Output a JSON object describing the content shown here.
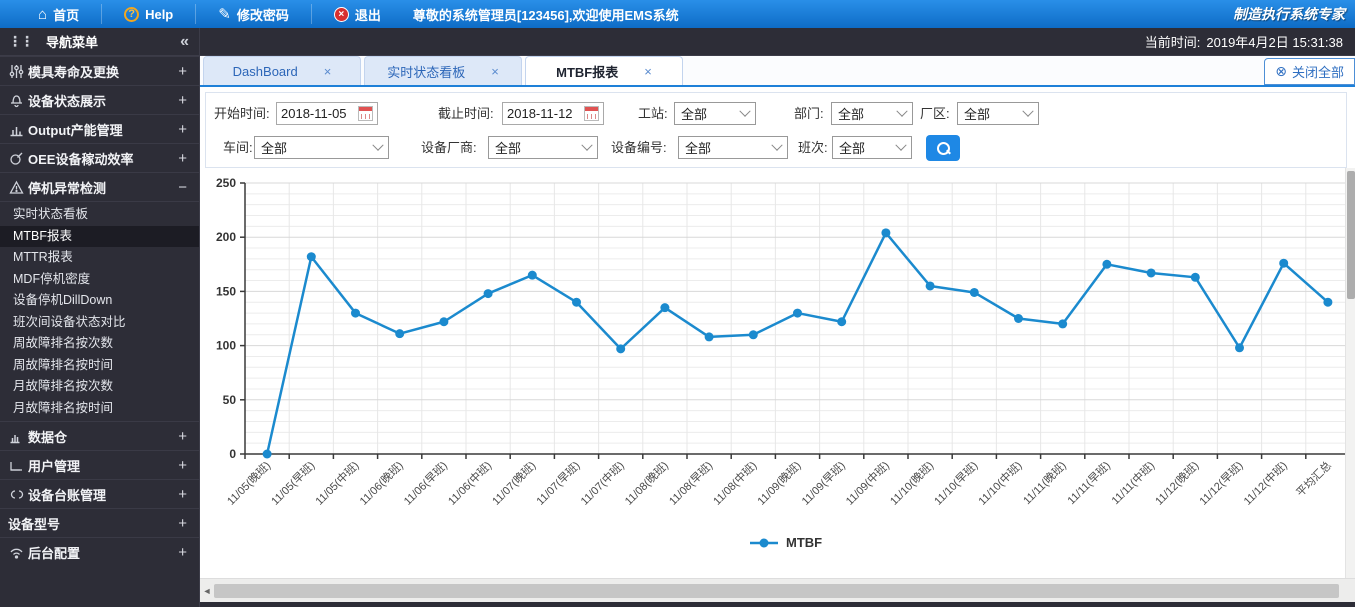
{
  "topbar": {
    "home": "首页",
    "help": "Help",
    "change_password": "修改密码",
    "logout": "退出",
    "welcome": "尊敬的系统管理员[123456],欢迎使用EMS系统",
    "brand": "制造执行系统专家"
  },
  "icons": {
    "home": "⌂",
    "help": "?",
    "edit": "✎",
    "logout": "×",
    "grip": "⋮⋮",
    "collapse": "«",
    "tab_close": "×",
    "close_all": "⊗",
    "hscroll_arrow": "◄"
  },
  "timebar": {
    "label": "当前时间:",
    "value": "2019年4月2日 15:31:38"
  },
  "sidebar": {
    "title": "导航菜单",
    "groups": [
      {
        "label": "模具寿命及更换",
        "expand": "+"
      },
      {
        "label": "设备状态展示",
        "expand": "+"
      },
      {
        "label": "Output产能管理",
        "expand": "+"
      },
      {
        "label": "OEE设备稼动效率",
        "expand": "+"
      },
      {
        "label": "停机异常检测",
        "expand": "−",
        "items": [
          "实时状态看板",
          "MTBF报表",
          "MTTR报表",
          "MDF停机密度",
          "设备停机DillDown",
          "班次间设备状态对比",
          "周故障排名按次数",
          "周故障排名按时间",
          "月故障排名按次数",
          "月故障排名按时间"
        ],
        "selected": "MTBF报表"
      },
      {
        "label": "数据仓",
        "expand": "+"
      },
      {
        "label": "用户管理",
        "expand": "+"
      },
      {
        "label": "设备台账管理",
        "expand": "+"
      },
      {
        "label": "设备型号",
        "expand": "+"
      },
      {
        "label": "后台配置",
        "expand": "+"
      }
    ]
  },
  "tabs": [
    {
      "label": "DashBoard",
      "active": false
    },
    {
      "label": "实时状态看板",
      "active": false
    },
    {
      "label": "MTBF报表",
      "active": true
    }
  ],
  "close_all_label": "关闭全部",
  "filters": {
    "row1": [
      {
        "label": "开始时间:",
        "value": "2018-11-05",
        "type": "date"
      },
      {
        "label": "截止时间:",
        "value": "2018-11-12",
        "type": "date"
      },
      {
        "label": "工站:",
        "value": "全部",
        "type": "select"
      },
      {
        "label": "部门:",
        "value": "全部",
        "type": "select"
      },
      {
        "label": "厂区:",
        "value": "全部",
        "type": "select"
      }
    ],
    "row2": [
      {
        "label": "车间:",
        "value": "全部",
        "type": "select"
      },
      {
        "label": "设备厂商:",
        "value": "全部",
        "type": "select"
      },
      {
        "label": "设备编号:",
        "value": "全部",
        "type": "select"
      },
      {
        "label": "班次:",
        "value": "全部",
        "type": "select"
      }
    ]
  },
  "chart_data": {
    "type": "line",
    "categories": [
      "11/05(晚班)",
      "11/05(早班)",
      "11/05(中班)",
      "11/06(晚班)",
      "11/06(早班)",
      "11/06(中班)",
      "11/07(晚班)",
      "11/07(早班)",
      "11/07(中班)",
      "11/08(晚班)",
      "11/08(早班)",
      "11/08(中班)",
      "11/09(晚班)",
      "11/09(早班)",
      "11/09(中班)",
      "11/10(晚班)",
      "11/10(早班)",
      "11/10(中班)",
      "11/11(晚班)",
      "11/11(早班)",
      "11/11(中班)",
      "11/12(晚班)",
      "11/12(早班)",
      "11/12(中班)",
      "平均汇总"
    ],
    "series": [
      {
        "name": "MTBF",
        "values": [
          0,
          182,
          130,
          111,
          122,
          148,
          165,
          140,
          97,
          135,
          108,
          110,
          130,
          122,
          204,
          155,
          149,
          125,
          120,
          175,
          167,
          163,
          98,
          176,
          140
        ]
      }
    ],
    "title": "",
    "xlabel": "",
    "ylabel": "",
    "ylim": [
      0,
      250
    ],
    "ytick_interval": 50,
    "minor_grid_interval": 10,
    "grid": true,
    "legend_position": "bottom",
    "colors": {
      "line": "#1b8ace",
      "grid_minor": "#ececec",
      "grid_major": "#d8d8d8",
      "grid_vert": "#e7e7e7",
      "axis": "#3a3a3a",
      "tick_label": "#333333",
      "x_label": "#4a4a4a",
      "legend_text": "#333333"
    }
  }
}
